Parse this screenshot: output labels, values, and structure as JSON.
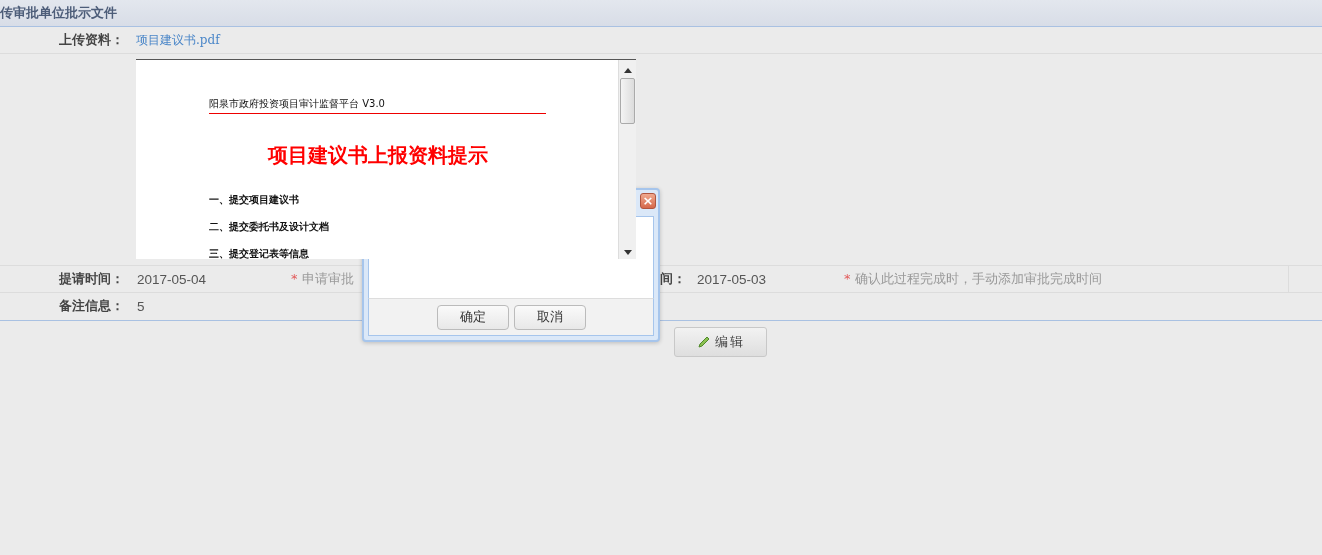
{
  "header": {
    "title": "传审批单位批示文件"
  },
  "upload": {
    "label": "上传资料：",
    "file": "项目建议书.pdf"
  },
  "preview": {
    "platform": "阳泉市政府投资项目审计监督平台 V3.0",
    "title": "项目建议书上报资料提示",
    "items": [
      "一、提交项目建议书",
      "二、提交委托书及设计文档",
      "三、提交登记表等信息"
    ]
  },
  "dates": {
    "label": "提请时间：",
    "value": "2017-05-04",
    "hint_mark": "*",
    "hint": "申请审批",
    "label_2": "间：",
    "value_2": "2017-05-03",
    "hint_2_mark": "*",
    "hint_2": "确认此过程完成时，手动添加审批完成时间"
  },
  "notes": {
    "label": "备注信息：",
    "value": "5"
  },
  "dialog": {
    "close": "×",
    "buttons": [
      "确定",
      "取消"
    ]
  },
  "edit_button": {
    "label": "编辑"
  }
}
